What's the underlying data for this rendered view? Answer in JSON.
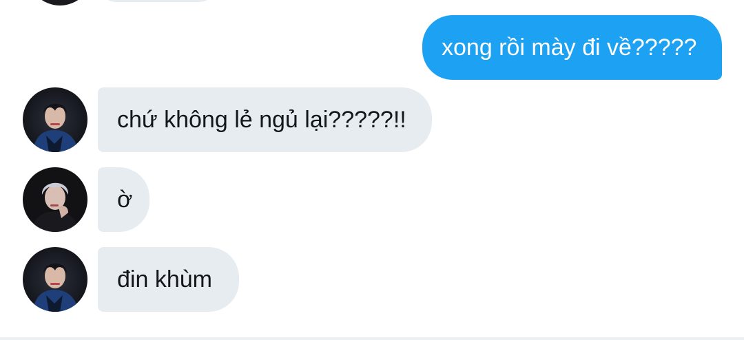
{
  "conversation": {
    "messages": [
      {
        "direction": "outgoing",
        "text": "xong rồi mày đi về?????"
      },
      {
        "direction": "incoming",
        "sender_avatar": "avatar-photo-dark-hair",
        "text": "chứ không lẻ ngủ lại?????!!"
      },
      {
        "direction": "incoming",
        "sender_avatar": "avatar-photo-silver-hair",
        "text": "ờ"
      },
      {
        "direction": "incoming",
        "sender_avatar": "avatar-photo-dark-hair",
        "text": "đin khùm"
      }
    ]
  },
  "colors": {
    "outgoing_bubble": "#1da1f2",
    "incoming_bubble": "#e6ecf0",
    "outgoing_text": "#ffffff",
    "incoming_text": "#14171a",
    "background": "#ffffff"
  }
}
